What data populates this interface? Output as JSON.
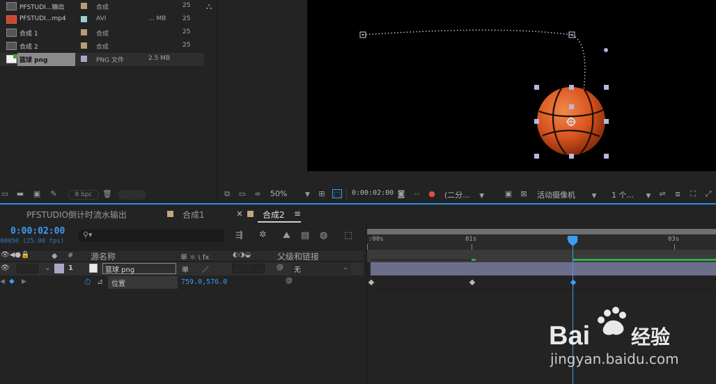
{
  "project_panel": {
    "items": [
      {
        "name": "PFSTUDI...输出",
        "type": "合成",
        "size": "",
        "fps": "25",
        "swatch": "#b69d75",
        "thumb": "comp"
      },
      {
        "name": "PFSTUDI...mp4",
        "type": "AVI",
        "size": "... MB",
        "fps": "25",
        "swatch": "#9ad0c8",
        "thumb": "avi"
      },
      {
        "name": "合成 1",
        "type": "合成",
        "size": "",
        "fps": "25",
        "swatch": "#b69d75",
        "thumb": "comp"
      },
      {
        "name": "合成 2",
        "type": "合成",
        "size": "",
        "fps": "25",
        "swatch": "#b69d75",
        "thumb": "comp"
      },
      {
        "name": "篮球 png",
        "type": "PNG 文件",
        "size": "2.5 MB",
        "fps": "",
        "swatch": "#a7a8c8",
        "thumb": "png"
      }
    ],
    "bpc": "8 bpc"
  },
  "viewer_bar": {
    "zoom": "50%",
    "timecode": "0:00:02:00",
    "resolution": "(二分...",
    "camera": "活动摄像机",
    "views": "1 个..."
  },
  "timeline": {
    "tabs": [
      {
        "label": "PFSTUDIO倒计时流水输出"
      },
      {
        "label": "合成1"
      },
      {
        "label": "合成2"
      }
    ],
    "timecode": "0:00:02:00",
    "fps_line": "00050 (25.00 fps)",
    "columns": {
      "num": "#",
      "source_name": "源名称",
      "switches": "单 ☼ \\ fx",
      "parent": "父级和链接"
    },
    "layer": {
      "index": "1",
      "name": "篮球 png",
      "parent": "无"
    },
    "property": {
      "name": "位置",
      "value": "759.0,576.0"
    },
    "ruler_ticks": [
      ":00s",
      "01s",
      "02s",
      "03s"
    ],
    "accent": "#2d8ceb"
  },
  "watermark": {
    "text": "jingyan.baidu.com",
    "brand": "Bai",
    "brand_cn": "经验"
  }
}
